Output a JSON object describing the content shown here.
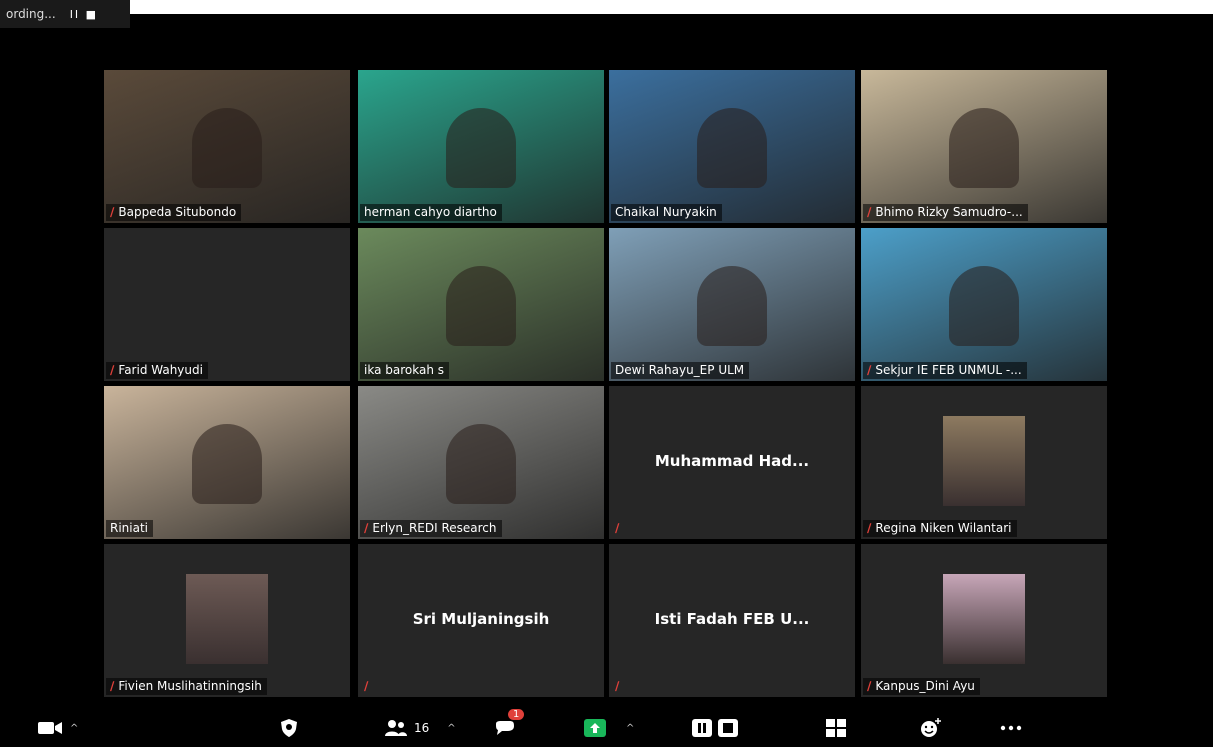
{
  "recording": {
    "text": "ording...",
    "controls": "II ■"
  },
  "participants": [
    {
      "name": "Bappeda Situbondo",
      "muted": true,
      "kind": "video",
      "bg": "#5a4a3a"
    },
    {
      "name": "herman cahyo diartho",
      "muted": false,
      "kind": "video",
      "bg": "#2aa58d"
    },
    {
      "name": "Chaikal Nuryakin",
      "muted": false,
      "kind": "video",
      "bg": "#3b6f9e"
    },
    {
      "name": "Bhimo Rizky Samudro-...",
      "muted": true,
      "kind": "video",
      "bg": "#c8b89a"
    },
    {
      "name": "Farid Wahyudi",
      "muted": true,
      "kind": "blank",
      "bg": "#262626"
    },
    {
      "name": "ika barokah s",
      "muted": false,
      "kind": "video",
      "bg": "#6b8a5c"
    },
    {
      "name": "Dewi Rahayu_EP ULM",
      "muted": false,
      "kind": "video",
      "bg": "#7f9fb7"
    },
    {
      "name": "Sekjur IE FEB UNMUL -...",
      "muted": true,
      "kind": "video",
      "bg": "#4c9fc9"
    },
    {
      "name": "Riniati",
      "muted": false,
      "kind": "video",
      "bg": "#c9b49b",
      "active": true
    },
    {
      "name": "Erlyn_REDI Research",
      "muted": true,
      "kind": "video",
      "bg": "#8a8a86"
    },
    {
      "name": "",
      "center": "Muhammad  Had...",
      "muted": true,
      "kind": "name"
    },
    {
      "name": "Regina Niken Wilantari",
      "muted": true,
      "kind": "thumb",
      "bg": "#8d7a60"
    },
    {
      "name": "Fivien Muslihatinningsih",
      "muted": true,
      "kind": "thumb",
      "bg": "#6d5a55"
    },
    {
      "name": "",
      "center": "Sri Muljaningsih",
      "muted": true,
      "kind": "name"
    },
    {
      "name": "",
      "center": "Isti Fadah FEB U...",
      "muted": true,
      "kind": "name"
    },
    {
      "name": "Kanpus_Dini Ayu",
      "muted": true,
      "kind": "thumb",
      "bg": "#c7a6b8"
    }
  ],
  "toolbar": {
    "participants_count": "16",
    "chat_badge": "1"
  },
  "colors": {
    "active_border": "#e3e66a",
    "mute": "#e0403a",
    "share": "#19b75a"
  }
}
